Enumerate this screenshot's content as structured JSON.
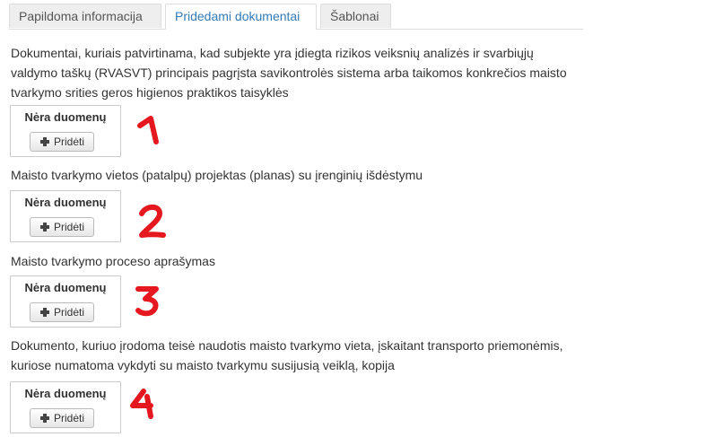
{
  "tabs": [
    {
      "label": "Papildoma informacija",
      "active": false
    },
    {
      "label": "Pridedami dokumentai",
      "active": true
    },
    {
      "label": "Šablonai",
      "active": false
    }
  ],
  "sections": [
    {
      "description": "Dokumentai, kuriais patvirtinama, kad subjekte yra įdiegta rizikos veiksnių analizės ir svarbiųjų valdymo taškų (RVASVT) principais pagrįsta savikontrolės sistema arba taikomos konkrečios maisto tvarkymo srities geros higienos praktikos taisyklės",
      "empty_text": "Nėra duomenų",
      "add_label": "Pridėti"
    },
    {
      "description": "Maisto tvarkymo vietos (patalpų) projektas (planas) su įrenginių išdėstymu",
      "empty_text": "Nėra duomenų",
      "add_label": "Pridėti"
    },
    {
      "description": "Maisto tvarkymo proceso aprašymas",
      "empty_text": "Nėra duomenų",
      "add_label": "Pridėti"
    },
    {
      "description": "Dokumento, kuriuo įrodoma teisė naudotis maisto tvarkymo vieta, įskaitant transporto priemonėmis, kuriose numatoma vykdyti su maisto tvarkymu susijusią veiklą, kopija",
      "empty_text": "Nėra duomenų",
      "add_label": "Pridėti"
    }
  ],
  "annotations": {
    "labels": [
      "1",
      "2",
      "3",
      "4"
    ],
    "color": "#e4181e"
  },
  "colors": {
    "active_tab_text": "#337ab7",
    "text": "#333333",
    "border": "#cccccc"
  }
}
